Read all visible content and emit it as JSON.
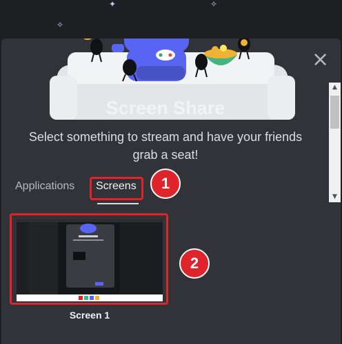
{
  "modal": {
    "title": "Screen Share",
    "subtitle": "Select something to stream and have your friends grab a seat!",
    "tabs": [
      {
        "label": "Applications",
        "active": false
      },
      {
        "label": "Screens",
        "active": true
      }
    ],
    "sources": [
      {
        "label": "Screen 1"
      }
    ]
  },
  "callouts": [
    "1",
    "2"
  ],
  "colors": {
    "backdrop": "#1e1f22",
    "modal_bg": "#313338",
    "hero_bg": "#e3e5e8",
    "blurple": "#5865f2",
    "highlight_red": "#e0242b"
  },
  "icons": [
    "close-icon",
    "sparkle-icon",
    "chevron-up-icon",
    "chevron-down-icon"
  ]
}
